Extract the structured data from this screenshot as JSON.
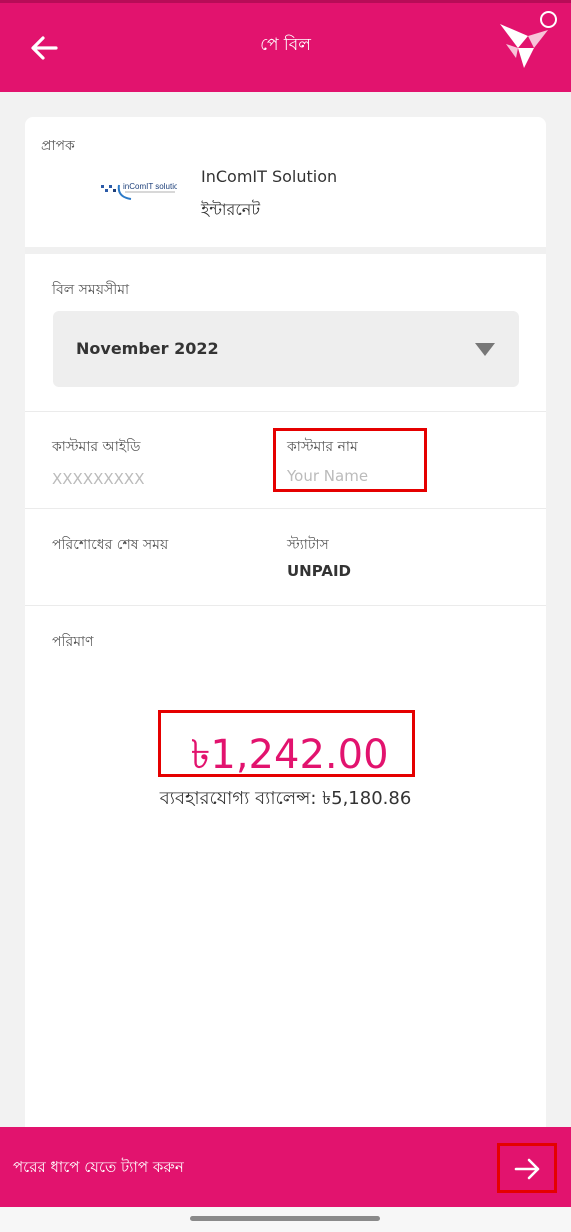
{
  "header": {
    "title": "পে বিল",
    "back_icon": "arrow-left-icon",
    "logo_icon": "bkash-bird-logo-icon"
  },
  "recipient": {
    "label": "প্রাপক",
    "logo_text": "inComIT solution",
    "name": "InComIT Solution",
    "type": "ইন্টারনেট"
  },
  "billing_period": {
    "label": "বিল সময়সীমা",
    "selected": "November 2022",
    "dropdown_icon": "triangle-down-icon"
  },
  "customer": {
    "id_label": "কাস্টমার আইডি",
    "id_value": "XXXXXXXXX",
    "name_label": "কাস্টমার নাম",
    "name_value": "Your Name"
  },
  "payment": {
    "due_label": "পরিশোধের শেষ সময়",
    "due_value": "",
    "status_label": "স্ট্যাটাস",
    "status_value": "UNPAID"
  },
  "amount": {
    "label": "পরিমাণ",
    "value": "৳1,242.00",
    "balance_text": "ব্যবহারযোগ্য ব্যালেন্স: ৳5,180.86"
  },
  "footer": {
    "text": "পরের ধাপে যেতে ট্যাপ করুন",
    "next_icon": "arrow-right-icon"
  },
  "colors": {
    "brand": "#e2136e",
    "highlight": "#e50000"
  }
}
